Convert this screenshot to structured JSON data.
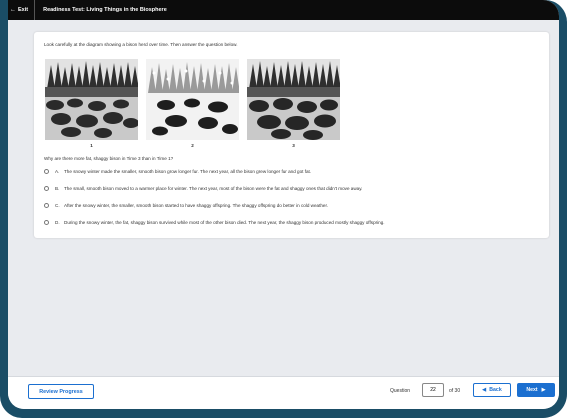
{
  "app": {
    "exit_label": "Exit",
    "test_title": "Readiness Test: Living Things in the Biosphere"
  },
  "question_card": {
    "instruction": "Look carefully at the diagram showing a bison herd over time. Then answer the question below.",
    "figures": [
      {
        "label": "1",
        "scene": "summer-bison-herd"
      },
      {
        "label": "2",
        "scene": "snowy-winter-bison-herd"
      },
      {
        "label": "3",
        "scene": "summer-shaggy-bison-herd"
      }
    ],
    "question": "Why are there more fat, shaggy bison in Time 3 than in Time 1?",
    "options": [
      {
        "letter": "A.",
        "text": "The snowy winter made the smaller, smooth bison grow longer fur. The next year, all the bison grew longer fur and got fat."
      },
      {
        "letter": "B.",
        "text": "The small, smooth bison moved to a warmer place for winter. The next year, most of the bison were the fat and shaggy ones that didn't move away."
      },
      {
        "letter": "C.",
        "text": "After the snowy winter, the smaller, smooth bison started to have shaggy offspring. The shaggy offspring do better in cold weather."
      },
      {
        "letter": "D.",
        "text": "During the snowy winter, the fat, shaggy bison survived while most of the other bison died. The next year, the shaggy bison produced mostly shaggy offspring."
      }
    ]
  },
  "footer": {
    "review_label": "Review Progress",
    "question_label": "Question",
    "question_number": "22",
    "of_total": "of 30",
    "back_label": "Back",
    "next_label": "Next"
  },
  "colors": {
    "accent": "#1b6fd0",
    "frame": "#1a4d66",
    "top_bar": "#0c0c0c",
    "background": "#e9ebef"
  }
}
